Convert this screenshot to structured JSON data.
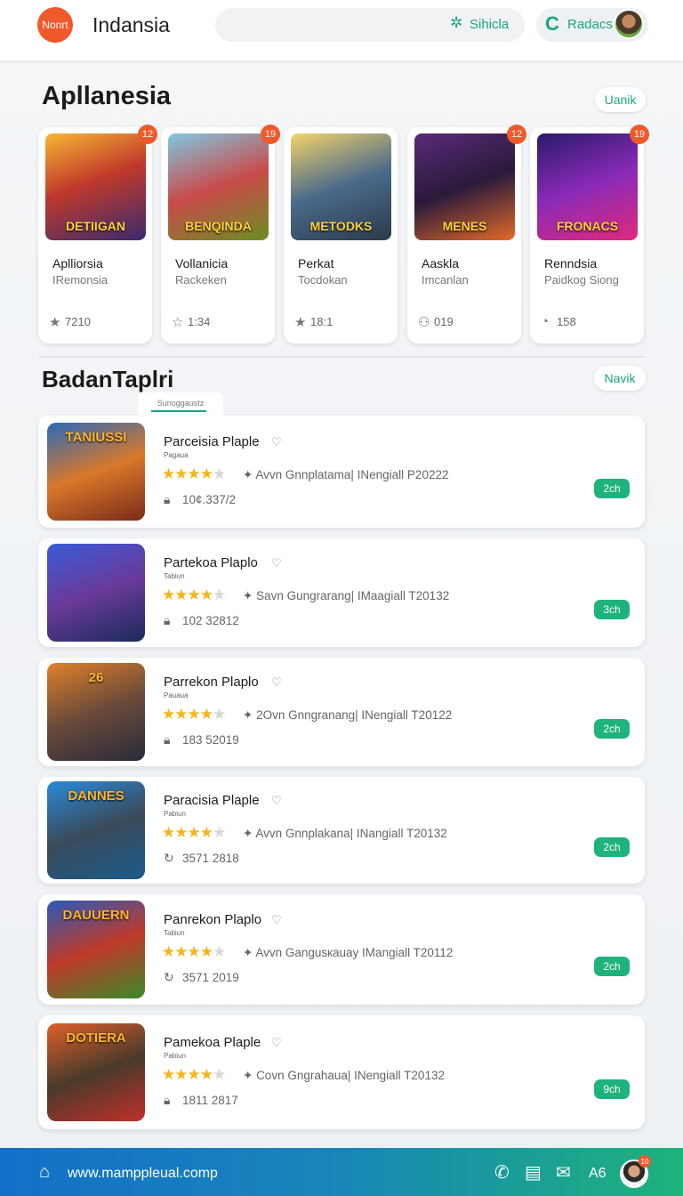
{
  "header": {
    "logo_text": "Nonrt",
    "title": "Indansia",
    "search_label": "Sihicla",
    "profile_label": "Radacs"
  },
  "featured": {
    "title": "Apllanesia",
    "action": "Uanik",
    "cards": [
      {
        "art": "DETIIGAN",
        "badge": "12",
        "name": "Aplliorsia",
        "sub": "IRemonsia",
        "stat_icon": "star-icon",
        "stat": "7210"
      },
      {
        "art": "BENQINDA",
        "badge": "19",
        "name": "Vollanicia",
        "sub": "Rackeken",
        "stat_icon": "star-outline-icon",
        "stat": "1:34"
      },
      {
        "art": "METODKS",
        "badge": "",
        "name": "Perkat",
        "sub": "Tocdokan",
        "stat_icon": "star-icon",
        "stat": "18:1"
      },
      {
        "art": "MENES",
        "badge": "12",
        "name": "Aaskla",
        "sub": "Imcanlan",
        "stat_icon": "users-icon",
        "stat": "019"
      },
      {
        "art": "FRONACS",
        "badge": "19",
        "name": "Renndsia",
        "sub": "Paidkog Siong",
        "stat_icon": "clock-icon",
        "stat": "158"
      }
    ]
  },
  "list": {
    "title": "BadanTaplri",
    "action": "Navik",
    "tab_label": "Sunoggaustz",
    "rows": [
      {
        "art": "TANIUSSI",
        "title": "Parceisia Plaple",
        "sub": "Pagaua",
        "stars": 4,
        "meta": "Avvn Gnnplatama| INengiall P20222",
        "stat_icon": "lock-icon",
        "stat": "10¢.337/2",
        "button": "2ch"
      },
      {
        "art": "",
        "title": "Partekoa Plaplo",
        "sub": "Tabiun",
        "stars": 4,
        "meta": "Savn Gungrarang| IMaagiall T20132",
        "stat_icon": "lock-icon",
        "stat": "102 32812",
        "button": "3ch"
      },
      {
        "art": "26",
        "title": "Parrekon Plaplo",
        "sub": "Pauaua",
        "stars": 4,
        "meta": "2Ovn Gnngranang| INengiall T20122",
        "stat_icon": "lock-icon",
        "stat": "183 52019",
        "button": "2ch"
      },
      {
        "art": "DANNES",
        "title": "Paracisia Plaple",
        "sub": "Pabiun",
        "stars": 4,
        "meta": "Avvn Gnnplakana| INangiall T20132",
        "stat_icon": "refresh-icon",
        "stat": "3571 2818",
        "button": "2ch"
      },
      {
        "art": "DAUUERN",
        "title": "Panrekon Plaplo",
        "sub": "Tabiun",
        "stars": 4,
        "meta": "Avvn Gangusкauay IMangiall T20112",
        "stat_icon": "refresh-icon",
        "stat": "3571 2019",
        "button": "2ch"
      },
      {
        "art": "DOTIERA",
        "title": "Pamekoa Plaple",
        "sub": "Pabiun",
        "stars": 4,
        "meta": "Covn Gngrahaua| INengiall T20132",
        "stat_icon": "lock-icon",
        "stat": "1811 2817",
        "button": "9ch"
      }
    ]
  },
  "footer": {
    "url": "www.mamppleual.comp",
    "right_text": "A6",
    "badge": "10"
  },
  "colors": {
    "accent": "#1aa87a",
    "badge": "#f0592a",
    "star": "#f6b41c"
  }
}
